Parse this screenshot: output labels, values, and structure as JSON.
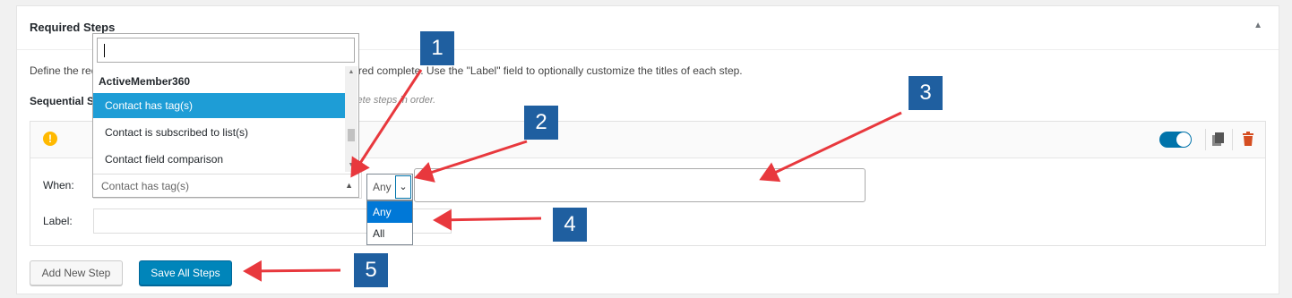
{
  "panel": {
    "title": "Required Steps",
    "description": "Define the required steps that must be met for this step to be considered complete. Use the \"Label\" field to optionally customize the titles of each step.",
    "sequential_label": "Sequential Steps",
    "sequential_hint": "plete steps in order."
  },
  "step": {
    "when_label": "When:",
    "label_label": "Label:",
    "condition_value": "Contact has tag(s)",
    "match_value": "Any",
    "match_options": [
      "Any",
      "All"
    ],
    "label_value": "",
    "tag_value": ""
  },
  "dropdown": {
    "search_value": "",
    "group": "ActiveMember360",
    "items": [
      "Contact has tag(s)",
      "Contact is subscribed to list(s)",
      "Contact field comparison"
    ],
    "highlighted": "Contact has tag(s)"
  },
  "buttons": {
    "add_new_step": "Add New Step",
    "save_all_steps": "Save All Steps"
  },
  "callouts": [
    "1",
    "2",
    "3",
    "4",
    "5"
  ],
  "colors": {
    "accent": "#0085ba",
    "highlight": "#1e9dd6",
    "selected_option": "#0078d7",
    "warning": "#ffb900",
    "trash": "#d54e21",
    "callout": "#1f5fa0",
    "arrow": "#e8383d"
  },
  "icons": [
    "collapse-arrow-icon",
    "warning-icon",
    "toggle-switch",
    "copy-icon",
    "trash-icon",
    "chevron-down-icon"
  ]
}
